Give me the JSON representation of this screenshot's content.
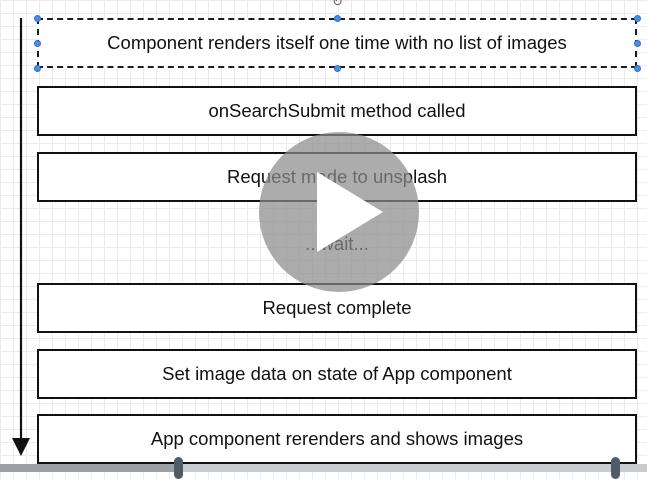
{
  "diagram": {
    "steps": [
      {
        "label": "Component renders itself one time with no list of images",
        "selected": true
      },
      {
        "label": "onSearchSubmit method called"
      },
      {
        "label": "Request made to unsplash"
      },
      {
        "label": "Request complete"
      },
      {
        "label": "Set image data on state of App component"
      },
      {
        "label": "App component rerenders and shows images"
      }
    ],
    "wait_label": "...wait..."
  },
  "icons": {
    "flow_arrow": "down-arrow-icon",
    "rotate": "rotate-icon",
    "play": "play-icon"
  },
  "colors": {
    "box_border": "#111111",
    "selection_handle": "#4a8fe7",
    "play_overlay": "#8c8c8c",
    "scrubber_knob": "#4f5b66"
  },
  "player": {
    "progress_fraction": 0.275,
    "loop_end_fraction": 0.95
  }
}
